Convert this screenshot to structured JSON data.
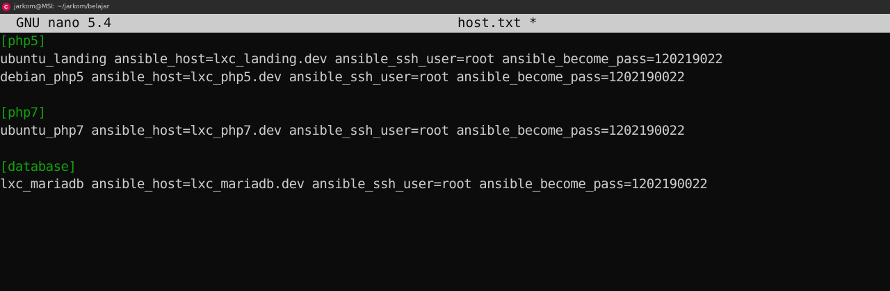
{
  "window": {
    "title": "jarkom@MSI: ~/jarkom/belajar",
    "icon": "debian-swirl-icon",
    "accent_color": "#d70a53"
  },
  "nano": {
    "version": "GNU nano 5.4",
    "filename": "host.txt *"
  },
  "colors": {
    "background": "#0c0c0c",
    "text": "#cccccc",
    "section_header": "#13a10e",
    "header_bar": "#cccccc"
  },
  "file_lines": [
    {
      "text": "[php5]",
      "kind": "section"
    },
    {
      "text": "ubuntu_landing ansible_host=lxc_landing.dev ansible_ssh_user=root ansible_become_pass=120219022",
      "kind": "entry"
    },
    {
      "text": "debian_php5 ansible_host=lxc_php5.dev ansible_ssh_user=root ansible_become_pass=1202190022",
      "kind": "entry"
    },
    {
      "text": "",
      "kind": "blank"
    },
    {
      "text": "[php7]",
      "kind": "section"
    },
    {
      "text": "ubuntu_php7 ansible_host=lxc_php7.dev ansible_ssh_user=root ansible_become_pass=1202190022",
      "kind": "entry"
    },
    {
      "text": "",
      "kind": "blank"
    },
    {
      "text": "[database]",
      "kind": "section"
    },
    {
      "text": "lxc_mariadb ansible_host=lxc_mariadb.dev ansible_ssh_user=root ansible_become_pass=1202190022",
      "kind": "entry"
    }
  ]
}
